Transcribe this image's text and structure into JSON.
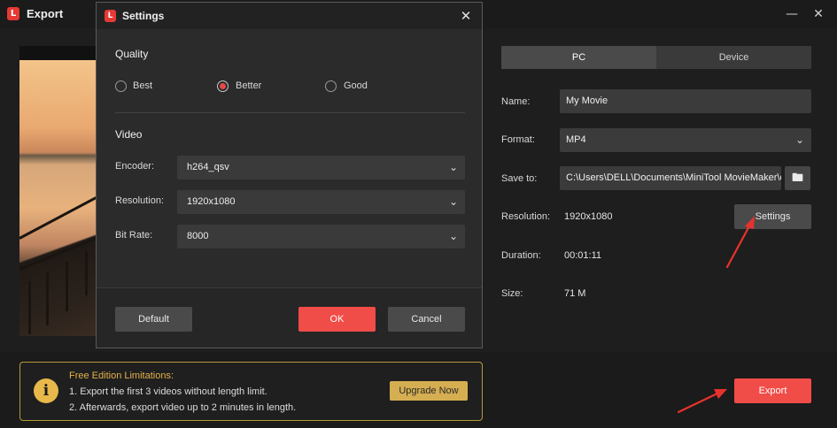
{
  "window": {
    "title": "Export",
    "logo_text": "L"
  },
  "tabs": {
    "pc": "PC",
    "device": "Device"
  },
  "form": {
    "name_label": "Name:",
    "name_value": "My Movie",
    "format_label": "Format:",
    "format_value": "MP4",
    "save_label": "Save to:",
    "save_value": "C:\\Users\\DELL\\Documents\\MiniTool MovieMaker\\out",
    "resolution_label": "Resolution:",
    "resolution_value": "1920x1080",
    "settings_button": "Settings",
    "duration_label": "Duration:",
    "duration_value": "00:01:11",
    "size_label": "Size:",
    "size_value": "71 M"
  },
  "limits": {
    "title": "Free Edition Limitations:",
    "line1": "1. Export the first 3 videos without length limit.",
    "line2": "2. Afterwards, export video up to 2 minutes in length.",
    "upgrade_button": "Upgrade Now",
    "icon_glyph": "i"
  },
  "export_button": "Export",
  "dialog": {
    "title": "Settings",
    "logo_text": "L",
    "quality_title": "Quality",
    "quality_options": [
      "Best",
      "Better",
      "Good"
    ],
    "quality_selected": "Better",
    "video_title": "Video",
    "encoder_label": "Encoder:",
    "encoder_value": "h264_qsv",
    "resolution_label": "Resolution:",
    "resolution_value": "1920x1080",
    "bitrate_label": "Bit Rate:",
    "bitrate_value": "8000",
    "default_button": "Default",
    "ok_button": "OK",
    "cancel_button": "Cancel"
  },
  "colors": {
    "accent": "#f04c48",
    "upgrade": "#d6ae52",
    "limit_border": "#b59a3c"
  },
  "icons": [
    "app-logo-icon",
    "minimize-icon",
    "close-icon",
    "chevron-down-icon",
    "folder-icon",
    "info-icon"
  ]
}
